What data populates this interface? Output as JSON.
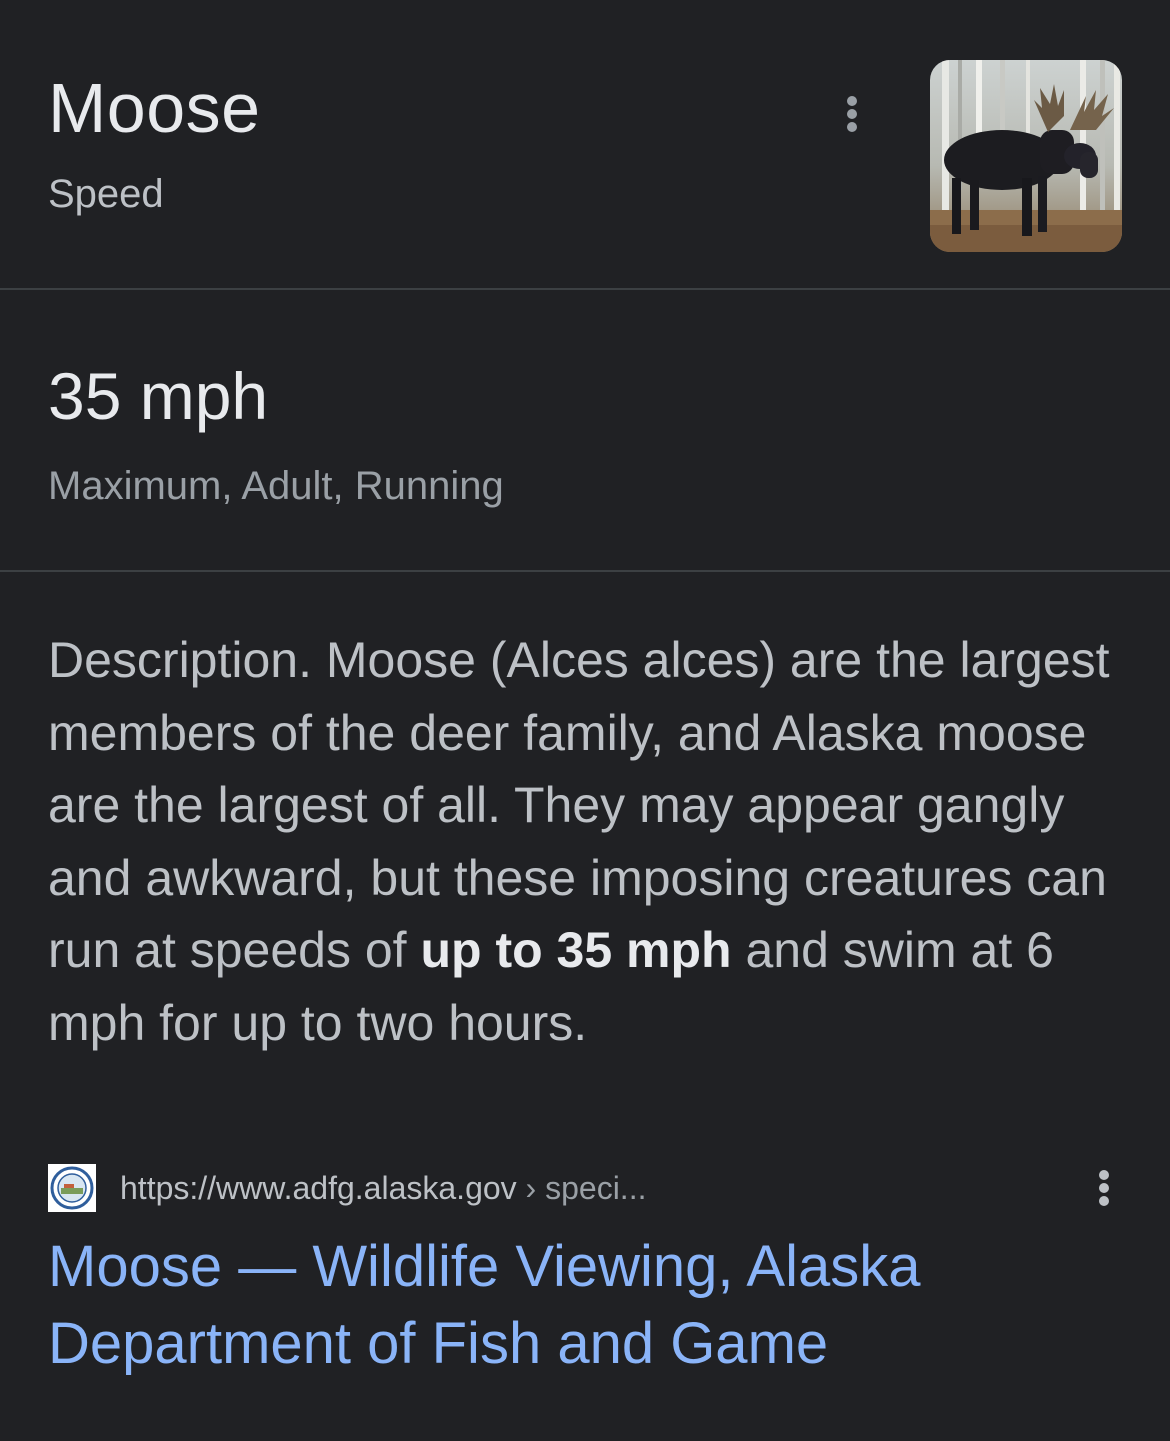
{
  "header": {
    "title": "Moose",
    "subtitle": "Speed",
    "more_icon": "more-vert-icon",
    "thumbnail": "moose-photo"
  },
  "answer": {
    "value": "35 mph",
    "qualifier": "Maximum, Adult, Running"
  },
  "snippet": {
    "text_before": "Description. Moose (Alces alces) are the largest members of the deer family, and Alaska moose are the largest of all. They may appear gangly and awkward, but these imposing creatures can run at speeds of ",
    "highlight": "up to 35 mph",
    "text_after": " and swim at 6 mph for up to two hours."
  },
  "source": {
    "favicon": "adfg-seal-icon",
    "url": "https://www.adfg.alaska.gov",
    "breadcrumb": " › speci...",
    "more_icon": "more-vert-icon"
  },
  "result": {
    "title": "Moose — Wildlife Viewing, Alaska Department of Fish and Game"
  },
  "colors": {
    "background": "#202124",
    "primary_text": "#e8eaed",
    "secondary_text": "#bdc1c6",
    "link": "#8ab4f8",
    "divider": "#3c4043"
  }
}
